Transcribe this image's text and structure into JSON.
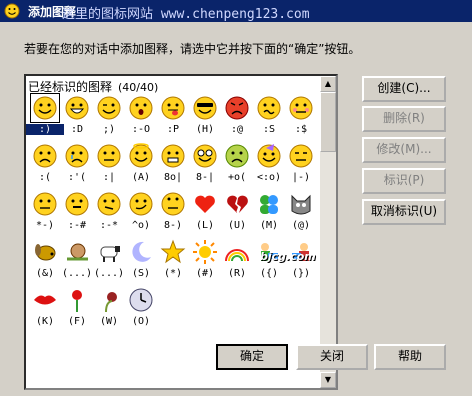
{
  "titlebar": {
    "title": "添加图释",
    "watermark": "这里的图标网站  www.chenpeng123.com"
  },
  "instruction": "若要在您的对话中添加图释，请选中它并按下面的“确定”按钮。",
  "list": {
    "header": "已经标识的图释",
    "count": "(40/40)",
    "items": [
      {
        "code": ":)",
        "icon": "smile"
      },
      {
        "code": ":D",
        "icon": "big-grin"
      },
      {
        "code": ";)",
        "icon": "wink"
      },
      {
        "code": ":-O",
        "icon": "surprised"
      },
      {
        "code": ":P",
        "icon": "tongue"
      },
      {
        "code": "(H)",
        "icon": "cool-sunglasses"
      },
      {
        "code": ":@",
        "icon": "angry"
      },
      {
        "code": ":S",
        "icon": "confused"
      },
      {
        "code": ":$",
        "icon": "embarrassed"
      },
      {
        "code": ":(",
        "icon": "sad"
      },
      {
        "code": ":'(",
        "icon": "crying"
      },
      {
        "code": ":|",
        "icon": "disappointed"
      },
      {
        "code": "(A)",
        "icon": "angel"
      },
      {
        "code": "8o|",
        "icon": "baring-teeth"
      },
      {
        "code": "8-|",
        "icon": "nerd"
      },
      {
        "code": "+o(",
        "icon": "sick"
      },
      {
        "code": "<:o)",
        "icon": "party"
      },
      {
        "code": "|-)",
        "icon": "sleepy"
      },
      {
        "code": "*-)",
        "icon": "thinking"
      },
      {
        "code": ":-#",
        "icon": "dont-tell"
      },
      {
        "code": ":-*",
        "icon": "secret"
      },
      {
        "code": "^o)",
        "icon": "sarcastic"
      },
      {
        "code": "8-)",
        "icon": "eye-roll"
      },
      {
        "code": "(L)",
        "icon": "red-heart"
      },
      {
        "code": "(U)",
        "icon": "broken-heart"
      },
      {
        "code": "(M)",
        "icon": "messenger"
      },
      {
        "code": "(@)",
        "icon": "cat-face"
      },
      {
        "code": "(&)",
        "icon": "dog-face"
      },
      {
        "code": "(...)",
        "icon": "snail"
      },
      {
        "code": "(...)",
        "icon": "sheep"
      },
      {
        "code": "(S)",
        "icon": "moon"
      },
      {
        "code": "(*)",
        "icon": "star"
      },
      {
        "code": "(#)",
        "icon": "sun"
      },
      {
        "code": "(R)",
        "icon": "rainbow"
      },
      {
        "code": "({)",
        "icon": "boy-hug"
      },
      {
        "code": "(})",
        "icon": "girl-hug"
      },
      {
        "code": "(K)",
        "icon": "red-lips"
      },
      {
        "code": "(F)",
        "icon": "red-rose"
      },
      {
        "code": "(W)",
        "icon": "wilted-rose"
      },
      {
        "code": "(O)",
        "icon": "clock"
      }
    ],
    "selected_index": 0
  },
  "buttons": {
    "create": "创建(C)...",
    "delete": "删除(R)",
    "modify": "修改(M)...",
    "identify": "标识(P)",
    "unidentify": "取消标识(U)",
    "ok": "确定",
    "close": "关闭",
    "help": "帮助"
  },
  "overlay": {
    "bjcg": "bjcg.com"
  },
  "colors": {
    "smiley": "#ffd21f",
    "title": "#0a246a",
    "selection": "#0a246a"
  }
}
